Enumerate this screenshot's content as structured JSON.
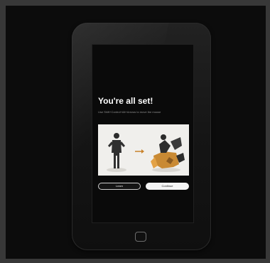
{
  "screen": {
    "headline": "You're all set!",
    "subtext": "Use Shift+Control+Alt+Arrows to move the mouse",
    "button_left_label": "Learn",
    "button_right_label": "Continue"
  }
}
